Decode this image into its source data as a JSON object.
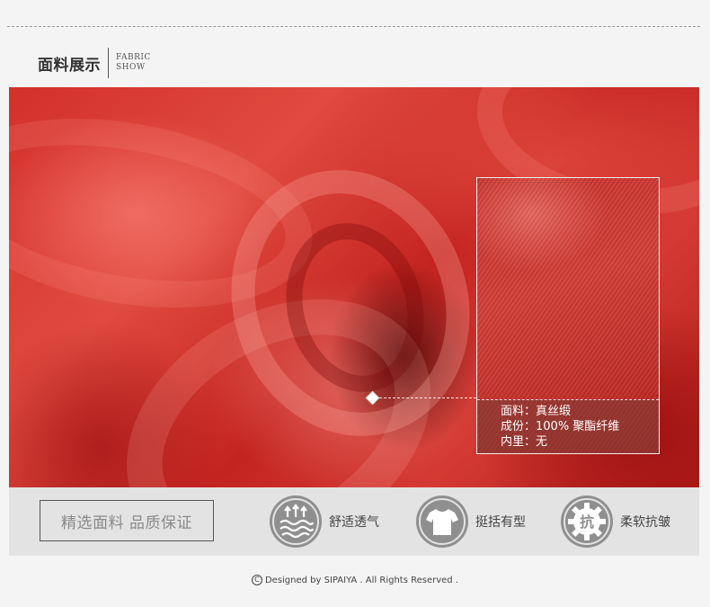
{
  "header": {
    "title": "面料展示",
    "en_line1": "FABRIC",
    "en_line2": "SHOW"
  },
  "zoom": {
    "fabric": "面料：真丝缎",
    "composition": "成份：100% 聚酯纤维",
    "lining": "内里：无"
  },
  "features": {
    "slogan": "精选面料  品质保证",
    "items": [
      {
        "label": "舒适透气",
        "icon": "breathable-icon"
      },
      {
        "label": "挺括有型",
        "icon": "tshirt-icon"
      },
      {
        "label": "柔软抗皱",
        "icon": "anti-wrinkle-gear-icon"
      }
    ],
    "anti_glyph": "抗"
  },
  "footer": {
    "copyright_symbol": "C",
    "text": "Designed by SIPAIYA . All Rights Reserved ."
  },
  "colors": {
    "fabric_red": "#d3302c",
    "icon_gray": "#8f8f8f",
    "bar_bg": "#e3e3e3"
  }
}
